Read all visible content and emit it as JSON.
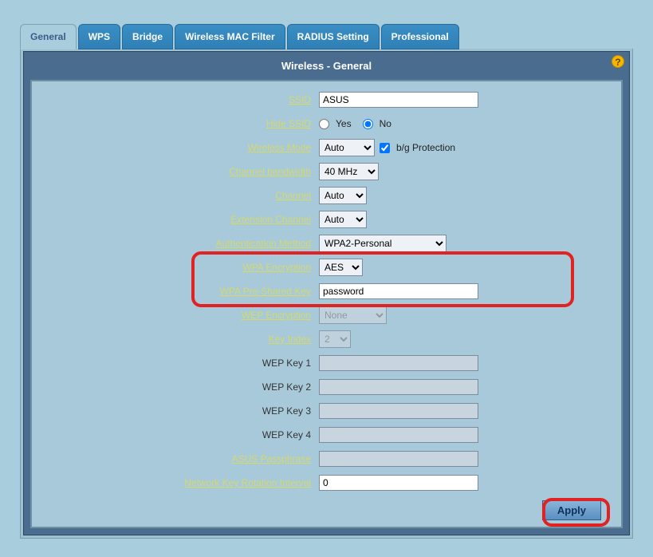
{
  "tabs": {
    "general": "General",
    "wps": "WPS",
    "bridge": "Bridge",
    "mac_filter": "Wireless MAC Filter",
    "radius": "RADIUS Setting",
    "professional": "Professional"
  },
  "panel_title": "Wireless - General",
  "labels": {
    "ssid": "SSID",
    "hide_ssid": "Hide SSID",
    "wireless_mode": "Wireless Mode",
    "channel_bandwidth": "Channel bandwidth",
    "channel": "Channel",
    "extension_channel": "Extension Channel",
    "auth_method": "Authentication Method",
    "wpa_encryption": "WPA Encryption",
    "wpa_psk": "WPA Pre-Shared Key",
    "wep_encryption": "WEP Encryption",
    "key_index": "Key Index",
    "wep_key_1": "WEP Key 1",
    "wep_key_2": "WEP Key 2",
    "wep_key_3": "WEP Key 3",
    "wep_key_4": "WEP Key 4",
    "asus_passphrase": "ASUS Passphrase",
    "rotation_interval": "Network Key Rotation Interval"
  },
  "values": {
    "ssid": "ASUS",
    "hide_ssid_yes": "Yes",
    "hide_ssid_no": "No",
    "hide_ssid_selected": "no",
    "wireless_mode": "Auto",
    "bg_protection_label": "b/g Protection",
    "bg_protection_checked": true,
    "channel_bandwidth": "40 MHz",
    "channel": "Auto",
    "extension_channel": "Auto",
    "auth_method": "WPA2-Personal",
    "wpa_encryption": "AES",
    "wpa_psk": "password",
    "wep_encryption": "None",
    "key_index": "2",
    "wep_key_1": "",
    "wep_key_2": "",
    "wep_key_3": "",
    "wep_key_4": "",
    "asus_passphrase": "",
    "rotation_interval": "0"
  },
  "apply_label": "Apply",
  "help_char": "?"
}
